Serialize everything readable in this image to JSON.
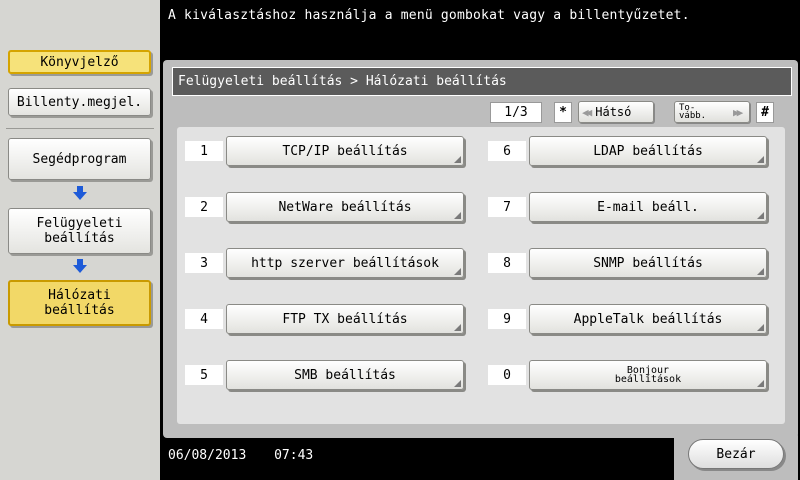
{
  "sidebar": {
    "counter_label": "Könyvjelző",
    "keyboard_label": "Billenty.megjel.",
    "breadcrumbs": [
      "Segédprogram",
      "Felügyeleti\nbeállítás",
      "Hálózati\nbeállítás"
    ]
  },
  "top_message": "A kiválasztáshoz használja a menü gombokat vagy a billentyűzetet.",
  "panel": {
    "title": "Felügyeleti beállítás > Hálózati beállítás",
    "page_indicator": "1/3",
    "star_key": "*",
    "hash_key": "#",
    "back_label": "Hátsó",
    "forward_label": "To-\nvább."
  },
  "items": [
    {
      "num": "1",
      "label": "TCP/IP beállítás"
    },
    {
      "num": "2",
      "label": "NetWare beállítás"
    },
    {
      "num": "3",
      "label": "http szerver beállítások"
    },
    {
      "num": "4",
      "label": "FTP TX beállítás"
    },
    {
      "num": "5",
      "label": "SMB beállítás"
    },
    {
      "num": "6",
      "label": "LDAP beállítás"
    },
    {
      "num": "7",
      "label": "E-mail beáll."
    },
    {
      "num": "8",
      "label": "SNMP beállítás"
    },
    {
      "num": "9",
      "label": "AppleTalk beállítás"
    },
    {
      "num": "0",
      "label": "Bonjour\nbeállítások"
    }
  ],
  "footer": {
    "date": "06/08/2013",
    "time": "07:43",
    "close_label": "Bezár"
  },
  "colors": {
    "accent_yellow": "#f6e27a",
    "title_bar": "#5b5b5b",
    "sidebar_bg": "#d6d6d2"
  }
}
